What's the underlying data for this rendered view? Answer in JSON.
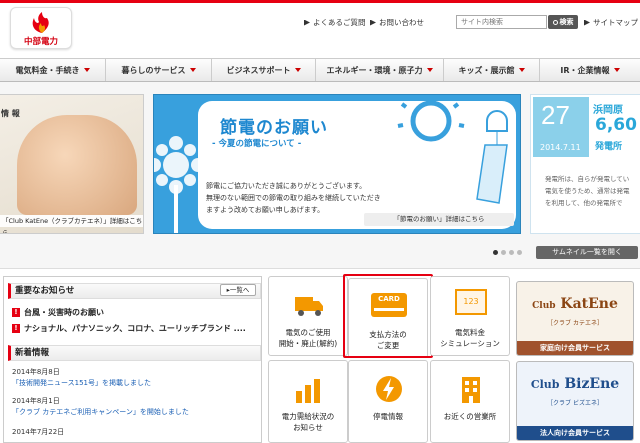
{
  "header": {
    "logo_text": "中部電力",
    "faq_link": "よくあるご質問",
    "contact_link": "お問い合わせ",
    "search_placeholder": "サイト内検索",
    "search_button": "検索",
    "sitemap_link": "サイトマップ"
  },
  "nav": [
    {
      "label": "電気料金・手続き"
    },
    {
      "label": "暮らしのサービス"
    },
    {
      "label": "ビジネスサポート"
    },
    {
      "label": "エネルギー・環境・原子力"
    },
    {
      "label": "キッズ・展示館"
    },
    {
      "label": "IR・企業情報"
    }
  ],
  "carousel": {
    "left_tag": "情 報",
    "left_caption": "「Club KatEne（クラブカテエネ）」詳細はこちら",
    "main_title": "節電のお願い",
    "main_subtitle": "- 今夏の節電について -",
    "main_body_1": "節電にご協力いただき誠にありがとうございます。",
    "main_body_2": "無理のない範囲での節電の取り組みを継続していただき",
    "main_body_3": "ますよう改めてお願い申しあげます。",
    "main_link": "「節電のお願い」詳細はこちら",
    "right_day": "27",
    "right_ym": "2014.7.11",
    "right_location": "浜岡原",
    "right_number": "6,60",
    "right_sub": "発電所",
    "right_body_1": "発電所は、自らが発電してい",
    "right_body_2": "電気を使うため、通常は発電",
    "right_body_3": "を利用して、他の発電所で",
    "thumb_button": "サムネイル一覧を開く"
  },
  "news": {
    "important_heading": "重要なお知らせ",
    "more_button": "一覧へ",
    "alerts": [
      {
        "text": "台風・災害時のお願い"
      },
      {
        "text": "ナショナル、パナソニック、コロナ、ユーリッチブランド ...."
      }
    ],
    "latest_heading": "新着情報",
    "items": [
      {
        "date": "2014年8月8日",
        "text": "「技術開発ニュース151号」を掲載しました"
      },
      {
        "date": "2014年8月1日",
        "text": "「クラブ カテエネご利用キャンペーン」を開始しました"
      },
      {
        "date": "2014年7月22日",
        "text": ""
      }
    ]
  },
  "tiles": [
    {
      "line1": "電気のご使用",
      "line2": "開始・廃止(解約)"
    },
    {
      "line1": "支払方法の",
      "line2": "ご変更",
      "card_text": "CARD"
    },
    {
      "line1": "電気料金",
      "line2": "シミュレーション",
      "screen_text": "123"
    },
    {
      "line1": "電力需給状況の",
      "line2": "お知らせ"
    },
    {
      "line1": "停電情報",
      "line2": ""
    },
    {
      "line1": "お近くの営業所",
      "line2": ""
    }
  ],
  "clubs": [
    {
      "logo_prefix": "Club",
      "logo_main": "KatEne",
      "sub": "［クラブ カテエネ］",
      "band": "家庭向け会員サービス",
      "color": "#a0522d"
    },
    {
      "logo_prefix": "Club",
      "logo_main": "BizEne",
      "sub": "［クラブ ビズエネ］",
      "band": "法人向け会員サービス",
      "color": "#1f4e8c"
    }
  ],
  "colors": {
    "brand_red": "#e60012",
    "sky_blue": "#38a0dd",
    "orange": "#f39800"
  }
}
